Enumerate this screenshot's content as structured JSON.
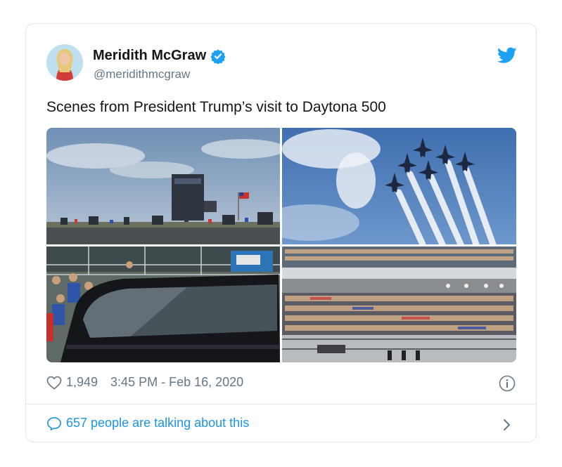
{
  "tweet": {
    "author_name": "Meridith McGraw",
    "author_handle": "@meridithmcgraw",
    "text": "Scenes from President Trump’s visit to Daytona 500",
    "likes": "1,949",
    "timestamp": "3:45 PM - Feb 16, 2020",
    "conversation_label": "657 people are talking about this"
  },
  "icons": {
    "verified": "verified-badge-icon",
    "logo": "twitter-bird-icon",
    "like": "heart-icon",
    "info": "info-icon",
    "conversation": "speech-bubble-icon",
    "more": "chevron-right-icon"
  },
  "colors": {
    "twitter_blue": "#1da1f2",
    "link_blue": "#1b95e0",
    "muted": "#657786",
    "border": "#e1e8ed"
  }
}
